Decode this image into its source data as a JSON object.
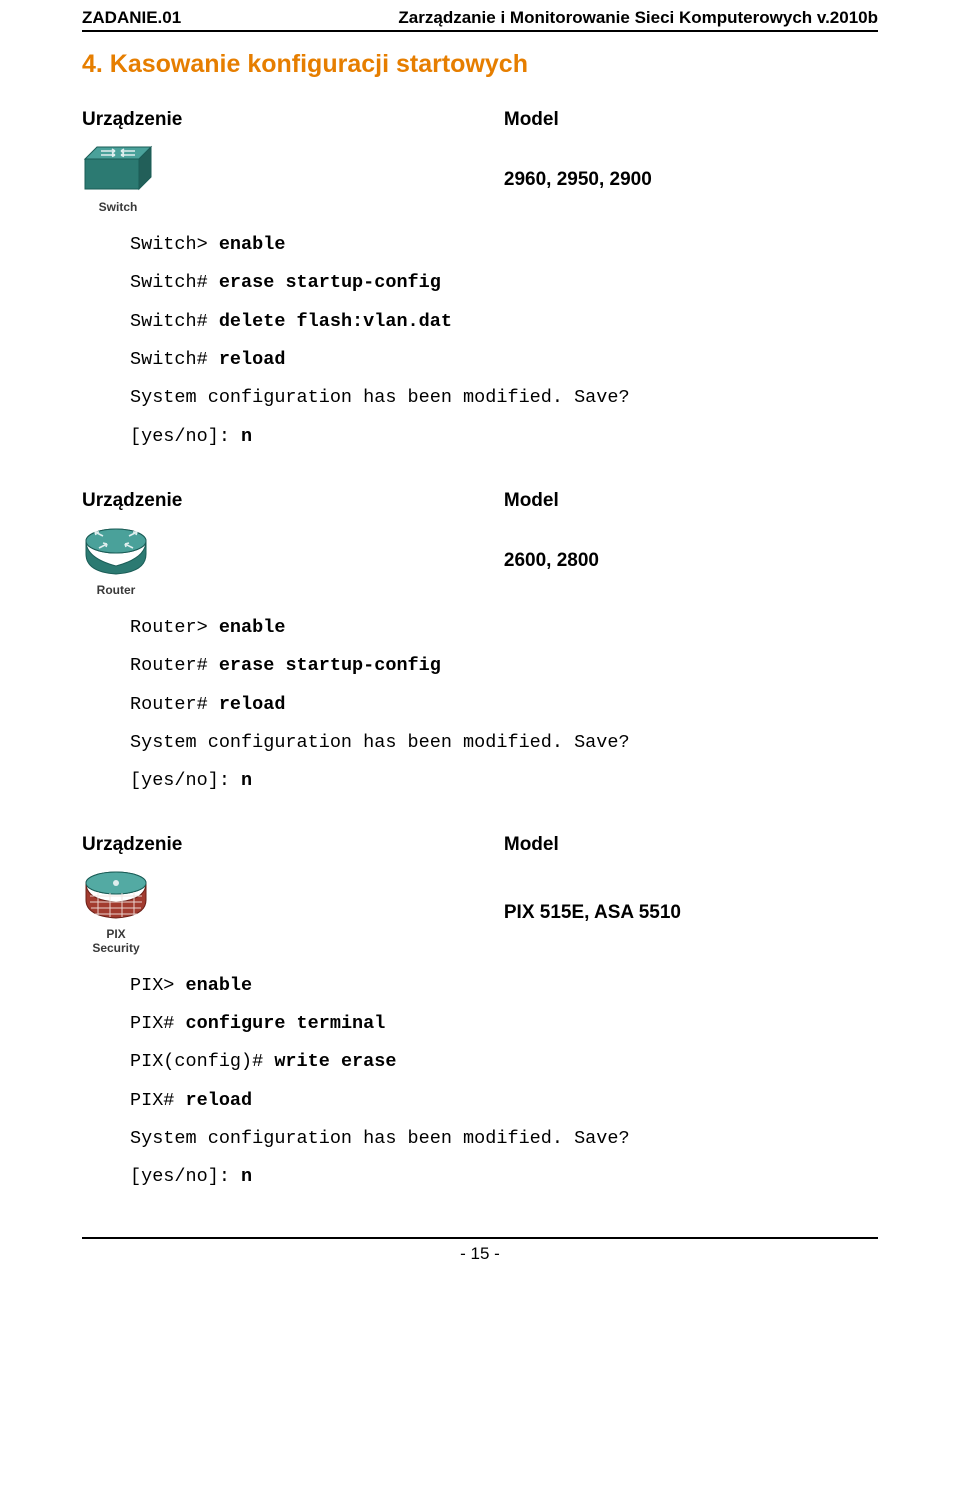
{
  "header": {
    "left": "ZADANIE.01",
    "right": "Zarządzanie i Monitorowanie Sieci Komputerowych v.2010b"
  },
  "section_title": "4.  Kasowanie konfiguracji startowych",
  "col_labels": {
    "device": "Urządzenie",
    "model": "Model"
  },
  "devices": {
    "switch": {
      "label": "Switch",
      "model": "2960, 2950, 2900"
    },
    "router": {
      "label": "Router",
      "model": "2600, 2800"
    },
    "pix": {
      "label": "PIX",
      "label2": "Security",
      "model": "PIX 515E, ASA 5510"
    }
  },
  "code": {
    "switch": {
      "l1a": "Switch> ",
      "l1b": "enable",
      "l2a": "Switch# ",
      "l2b": "erase startup-config",
      "l3a": "Switch# ",
      "l3b": "delete flash:vlan.dat",
      "l4a": "Switch# ",
      "l4b": "reload",
      "l5": "System configuration has been modified. Save?",
      "l6a": "[yes/no]: ",
      "l6b": "n"
    },
    "router": {
      "l1a": "Router> ",
      "l1b": "enable",
      "l2a": "Router# ",
      "l2b": "erase startup-config",
      "l3a": "Router# ",
      "l3b": "reload",
      "l4": "System configuration has been modified. Save?",
      "l5a": "[yes/no]: ",
      "l5b": "n"
    },
    "pix": {
      "l1a": "PIX> ",
      "l1b": "enable",
      "l2a": "PIX# ",
      "l2b": "configure terminal",
      "l3a": "PIX(config)# ",
      "l3b": "write erase",
      "l4a": "PIX# ",
      "l4b": "reload",
      "l5": "System configuration has been modified. Save?",
      "l6a": "[yes/no]: ",
      "l6b": "n"
    }
  },
  "footer": {
    "page": "- 15 -"
  }
}
